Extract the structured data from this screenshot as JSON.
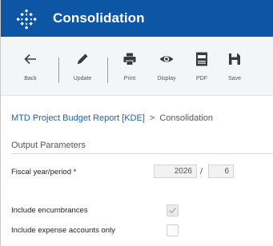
{
  "app": {
    "title": "Consolidation",
    "logo_icon": "sap-consolidation-logo"
  },
  "toolbar": {
    "back_label": "Back",
    "update_label": "Update",
    "print_label": "Print",
    "display_label": "Display",
    "pdf_label": "PDF",
    "save_label": "Save"
  },
  "breadcrumb": {
    "link": "MTD Project Budget Report [KDE]",
    "separator": ">",
    "current": "Consolidation"
  },
  "section": {
    "title": "Output Parameters"
  },
  "form": {
    "fiscal_label": "Fiscal year/period *",
    "fiscal_year": "2026",
    "period_separator": "/",
    "fiscal_period": "6",
    "encumbrances_label": "Include encumbrances",
    "encumbrances_checked": true,
    "expense_only_label": "Include expense accounts only",
    "expense_only_checked": false
  },
  "colors": {
    "titlebar": "#0d56a6",
    "link": "#2163ad",
    "icon": "#3a3a3a"
  }
}
